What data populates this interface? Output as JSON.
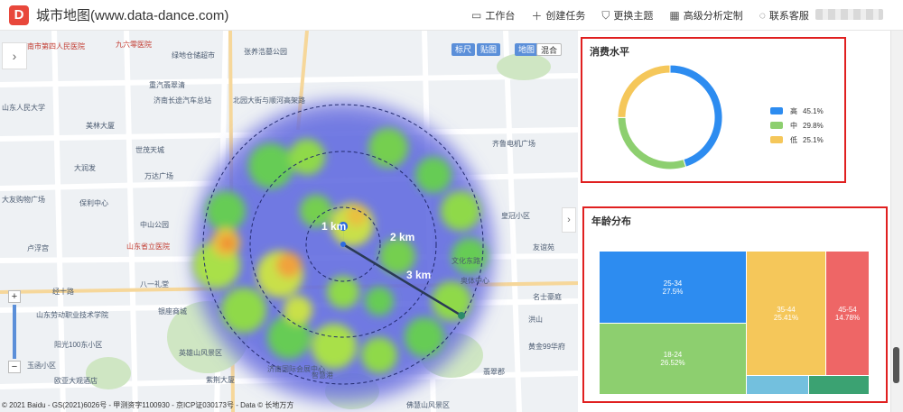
{
  "header": {
    "logo_letter": "D",
    "title": "城市地图(www.data-dance.com)",
    "nav": [
      {
        "label": "工作台",
        "icon": "monitor-icon"
      },
      {
        "label": "创建任务",
        "icon": "plus-icon"
      },
      {
        "label": "更换主题",
        "icon": "shirt-icon"
      },
      {
        "label": "高级分析定制",
        "icon": "calendar-icon"
      },
      {
        "label": "联系客服",
        "icon": "headset-icon"
      }
    ]
  },
  "map": {
    "controls": [
      "标尺",
      "贴图",
      "地图",
      "混合"
    ],
    "rings": [
      "1 km",
      "2 km",
      "3 km"
    ],
    "copyright": "© 2021 Baidu - GS(2021)6026号 - 甲测资字1100930 - 京ICP证030173号 - Data © 长地万方",
    "pois": [
      {
        "t": "济南市第四人民医院",
        "red": true
      },
      {
        "t": "九六零医院",
        "red": true
      },
      {
        "t": "绿地仓储超市"
      },
      {
        "t": "张养浩墓公园"
      },
      {
        "t": "山东人民大学"
      },
      {
        "t": "美林大厦"
      },
      {
        "t": "世茂天城"
      },
      {
        "t": "济南长途汽车总站"
      },
      {
        "t": "北园大街与顺河高架路"
      },
      {
        "t": "大润发"
      },
      {
        "t": "万达广场"
      },
      {
        "t": "大友购物广场"
      },
      {
        "t": "保利中心"
      },
      {
        "t": "中山公园"
      },
      {
        "t": "山东省立医院",
        "red": true
      },
      {
        "t": "卢浮宫"
      },
      {
        "t": "八一礼堂"
      },
      {
        "t": "银座商城"
      },
      {
        "t": "阳光100东小区"
      },
      {
        "t": "玉函小区"
      },
      {
        "t": "欧亚大观酒店"
      },
      {
        "t": "英雄山风景区"
      },
      {
        "t": "紫荆大厦"
      },
      {
        "t": "济南国际会展中心"
      },
      {
        "t": "智慧港"
      },
      {
        "t": "山东劳动职业技术学院"
      },
      {
        "t": "经十路"
      },
      {
        "t": "齐鲁电机广场"
      },
      {
        "t": "文化东路"
      },
      {
        "t": "奥体中心"
      },
      {
        "t": "皇冠小区"
      },
      {
        "t": "友谊苑"
      },
      {
        "t": "名士豪庭"
      },
      {
        "t": "洪山"
      },
      {
        "t": "黄金99华府"
      },
      {
        "t": "翡翠郡"
      },
      {
        "t": "佛慧山风景区"
      },
      {
        "t": "重汽翡翠清"
      }
    ]
  },
  "consumption": {
    "title": "消费水平",
    "legend": [
      {
        "name": "高",
        "value": "45.1%",
        "color": "#2d8cf0"
      },
      {
        "name": "中",
        "value": "29.8%",
        "color": "#8dcf6f"
      },
      {
        "name": "低",
        "value": "25.1%",
        "color": "#f5c75a"
      }
    ]
  },
  "age": {
    "title": "年龄分布",
    "blocks": [
      {
        "label": "25-34",
        "pct": "27.5%",
        "color": "#2d8cf0"
      },
      {
        "label": "18-24",
        "pct": "26.52%",
        "color": "#8dcf6f"
      },
      {
        "label": "35-44",
        "pct": "25.41%",
        "color": "#f5c75a"
      },
      {
        "label": "45-54",
        "pct": "14.78%",
        "color": "#ee6666"
      },
      {
        "label": "",
        "pct": "",
        "color": "#73c0de"
      },
      {
        "label": "",
        "pct": "",
        "color": "#3ba272"
      }
    ]
  },
  "chart_data": [
    {
      "type": "pie",
      "title": "消费水平",
      "categories": [
        "高",
        "中",
        "低"
      ],
      "values": [
        45.1,
        29.8,
        25.1
      ],
      "legend": "right"
    },
    {
      "type": "treemap",
      "title": "年龄分布",
      "categories": [
        "25-34",
        "18-24",
        "35-44",
        "45-54"
      ],
      "values": [
        27.5,
        26.52,
        25.41,
        14.78
      ]
    }
  ]
}
